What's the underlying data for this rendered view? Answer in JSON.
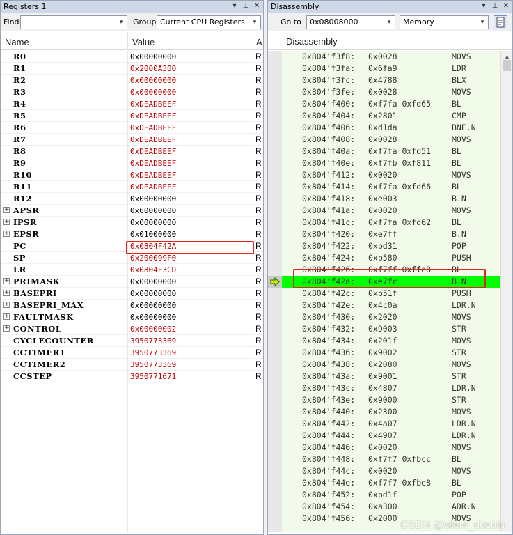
{
  "registers_panel": {
    "title": "Registers 1",
    "find_label": "Find:",
    "find_value": "",
    "group_label": "Group:",
    "group_value": "Current CPU Registers",
    "columns": [
      "Name",
      "Value",
      "A"
    ],
    "rows": [
      {
        "name": "R0",
        "value": "0x00000000",
        "access": "R",
        "expandable": false,
        "value_color": "#000000"
      },
      {
        "name": "R1",
        "value": "0x2000A300",
        "access": "R",
        "expandable": false,
        "value_color": "#c00000"
      },
      {
        "name": "R2",
        "value": "0x00000000",
        "access": "R",
        "expandable": false,
        "value_color": "#c00000"
      },
      {
        "name": "R3",
        "value": "0x00000000",
        "access": "R",
        "expandable": false,
        "value_color": "#c00000"
      },
      {
        "name": "R4",
        "value": "0xDEADBEEF",
        "access": "R",
        "expandable": false,
        "value_color": "#c00000"
      },
      {
        "name": "R5",
        "value": "0xDEADBEEF",
        "access": "R",
        "expandable": false,
        "value_color": "#c00000"
      },
      {
        "name": "R6",
        "value": "0xDEADBEEF",
        "access": "R",
        "expandable": false,
        "value_color": "#c00000"
      },
      {
        "name": "R7",
        "value": "0xDEADBEEF",
        "access": "R",
        "expandable": false,
        "value_color": "#c00000"
      },
      {
        "name": "R8",
        "value": "0xDEADBEEF",
        "access": "R",
        "expandable": false,
        "value_color": "#c00000"
      },
      {
        "name": "R9",
        "value": "0xDEADBEEF",
        "access": "R",
        "expandable": false,
        "value_color": "#c00000"
      },
      {
        "name": "R10",
        "value": "0xDEADBEEF",
        "access": "R",
        "expandable": false,
        "value_color": "#c00000"
      },
      {
        "name": "R11",
        "value": "0xDEADBEEF",
        "access": "R",
        "expandable": false,
        "value_color": "#c00000"
      },
      {
        "name": "R12",
        "value": "0x00000000",
        "access": "R",
        "expandable": false,
        "value_color": "#000000"
      },
      {
        "name": "APSR",
        "value": "0x60000000",
        "access": "R",
        "expandable": true,
        "value_color": "#000000"
      },
      {
        "name": "IPSR",
        "value": "0x00000000",
        "access": "R",
        "expandable": true,
        "value_color": "#000000"
      },
      {
        "name": "EPSR",
        "value": "0x01000000",
        "access": "R",
        "expandable": true,
        "value_color": "#000000"
      },
      {
        "name": "PC",
        "value": "0x0804F42A",
        "access": "R",
        "expandable": false,
        "value_color": "#c00000"
      },
      {
        "name": "SP",
        "value": "0x200099F0",
        "access": "R",
        "expandable": false,
        "value_color": "#c00000"
      },
      {
        "name": "LR",
        "value": "0x0804F3CD",
        "access": "R",
        "expandable": false,
        "value_color": "#c00000"
      },
      {
        "name": "PRIMASK",
        "value": "0x00000000",
        "access": "R",
        "expandable": true,
        "value_color": "#000000"
      },
      {
        "name": "BASEPRI",
        "value": "0x00000000",
        "access": "R",
        "expandable": true,
        "value_color": "#000000"
      },
      {
        "name": "BASEPRI_MAX",
        "value": "0x00000000",
        "access": "R",
        "expandable": true,
        "value_color": "#000000"
      },
      {
        "name": "FAULTMASK",
        "value": "0x00000000",
        "access": "R",
        "expandable": true,
        "value_color": "#000000"
      },
      {
        "name": "CONTROL",
        "value": "0x00000002",
        "access": "R",
        "expandable": true,
        "value_color": "#c00000"
      },
      {
        "name": "CYCLECOUNTER",
        "value": "3950773369",
        "access": "R",
        "expandable": false,
        "value_color": "#c00000"
      },
      {
        "name": "CCTIMER1",
        "value": "3950773369",
        "access": "R",
        "expandable": false,
        "value_color": "#c00000"
      },
      {
        "name": "CCTIMER2",
        "value": "3950773369",
        "access": "R",
        "expandable": false,
        "value_color": "#c00000"
      },
      {
        "name": "CCSTEP",
        "value": "3950771671",
        "access": "R",
        "expandable": false,
        "value_color": "#c00000"
      }
    ]
  },
  "disassembly_panel": {
    "title": "Disassembly",
    "goto_label": "Go to",
    "goto_value": "0x08008000",
    "mode_value": "Memory",
    "column_header": "Disassembly",
    "current_row": 19,
    "rows": [
      {
        "addr": "0x804'f3f8:",
        "op": "0x0028",
        "mn": "MOVS"
      },
      {
        "addr": "0x804'f3fa:",
        "op": "0x6fa9",
        "mn": "LDR"
      },
      {
        "addr": "0x804'f3fc:",
        "op": "0x4788",
        "mn": "BLX"
      },
      {
        "addr": "0x804'f3fe:",
        "op": "0x0028",
        "mn": "MOVS"
      },
      {
        "addr": "0x804'f400:",
        "op": "0xf7fa 0xfd65",
        "mn": "BL"
      },
      {
        "addr": "0x804'f404:",
        "op": "0x2801",
        "mn": "CMP"
      },
      {
        "addr": "0x804'f406:",
        "op": "0xd1da",
        "mn": "BNE.N"
      },
      {
        "addr": "0x804'f408:",
        "op": "0x0028",
        "mn": "MOVS"
      },
      {
        "addr": "0x804'f40a:",
        "op": "0xf7fa 0xfd51",
        "mn": "BL"
      },
      {
        "addr": "0x804'f40e:",
        "op": "0xf7fb 0xf811",
        "mn": "BL"
      },
      {
        "addr": "0x804'f412:",
        "op": "0x0020",
        "mn": "MOVS"
      },
      {
        "addr": "0x804'f414:",
        "op": "0xf7fa 0xfd66",
        "mn": "BL"
      },
      {
        "addr": "0x804'f418:",
        "op": "0xe003",
        "mn": "B.N"
      },
      {
        "addr": "0x804'f41a:",
        "op": "0x0020",
        "mn": "MOVS"
      },
      {
        "addr": "0x804'f41c:",
        "op": "0xf7fa 0xfd62",
        "mn": "BL"
      },
      {
        "addr": "0x804'f420:",
        "op": "0xe7ff",
        "mn": "B.N"
      },
      {
        "addr": "0x804'f422:",
        "op": "0xbd31",
        "mn": "POP"
      },
      {
        "addr": "0x804'f424:",
        "op": "0xb580",
        "mn": "PUSH"
      },
      {
        "addr": "0x804'f426:",
        "op": "0xf7ff 0xffe8",
        "mn": "BL"
      },
      {
        "addr": "0x804'f42a:",
        "op": "0xe7fc",
        "mn": "B.N"
      },
      {
        "addr": "0x804'f42c:",
        "op": "0xb51f",
        "mn": "PUSH"
      },
      {
        "addr": "0x804'f42e:",
        "op": "0x4c0a",
        "mn": "LDR.N"
      },
      {
        "addr": "0x804'f430:",
        "op": "0x2020",
        "mn": "MOVS"
      },
      {
        "addr": "0x804'f432:",
        "op": "0x9003",
        "mn": "STR"
      },
      {
        "addr": "0x804'f434:",
        "op": "0x201f",
        "mn": "MOVS"
      },
      {
        "addr": "0x804'f436:",
        "op": "0x9002",
        "mn": "STR"
      },
      {
        "addr": "0x804'f438:",
        "op": "0x2080",
        "mn": "MOVS"
      },
      {
        "addr": "0x804'f43a:",
        "op": "0x9001",
        "mn": "STR"
      },
      {
        "addr": "0x804'f43c:",
        "op": "0x4807",
        "mn": "LDR.N"
      },
      {
        "addr": "0x804'f43e:",
        "op": "0x9000",
        "mn": "STR"
      },
      {
        "addr": "0x804'f440:",
        "op": "0x2300",
        "mn": "MOVS"
      },
      {
        "addr": "0x804'f442:",
        "op": "0x4a07",
        "mn": "LDR.N"
      },
      {
        "addr": "0x804'f444:",
        "op": "0x4907",
        "mn": "LDR.N"
      },
      {
        "addr": "0x804'f446:",
        "op": "0x0020",
        "mn": "MOVS"
      },
      {
        "addr": "0x804'f448:",
        "op": "0xf7f7 0xfbcc",
        "mn": "BL"
      },
      {
        "addr": "0x804'f44c:",
        "op": "0x0020",
        "mn": "MOVS"
      },
      {
        "addr": "0x804'f44e:",
        "op": "0xf7f7 0xfbe8",
        "mn": "BL"
      },
      {
        "addr": "0x804'f452:",
        "op": "0xbd1f",
        "mn": "POP"
      },
      {
        "addr": "0x804'f454:",
        "op": "0xa300",
        "mn": "ADR.N"
      },
      {
        "addr": "0x804'f456:",
        "op": "0x2000",
        "mn": "MOVS"
      }
    ]
  },
  "watermark": "CSDN @silent_dusbin",
  "colors": {
    "current_instruction": "#00ff00",
    "changed_value": "#c00000",
    "highlight_box": "#e0261c",
    "disasm_background": "#f2fbe9"
  }
}
